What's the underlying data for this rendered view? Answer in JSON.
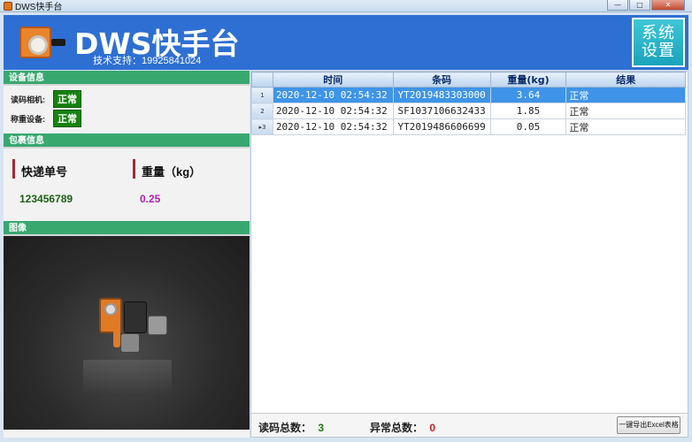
{
  "window": {
    "title": "DWS快手台",
    "minimize": "—",
    "maximize": "□",
    "close": "✕"
  },
  "header": {
    "title": "DWS快手台",
    "support": "技术支持：19925841024",
    "settings_label_line1": "系统",
    "settings_label_line2": "设置",
    "brand_color": "#2e6fd3"
  },
  "device": {
    "section_title": "设备信息",
    "camera_label": "读码相机:",
    "camera_status": "正常",
    "scale_label": "称重设备:",
    "scale_status": "正常",
    "status_color": "#16820f"
  },
  "package": {
    "section_title": "包裹信息",
    "tracking_label": "快递单号",
    "tracking_value": "123456789",
    "weight_label": "重量（kg）",
    "weight_value": "0.25"
  },
  "image": {
    "section_title": "图像"
  },
  "table": {
    "columns": [
      "时间",
      "条码",
      "重量(kg)",
      "结果"
    ],
    "rows": [
      {
        "num": "1",
        "time": "2020-12-10 02:54:32",
        "code": "YT2019483303000",
        "weight": "3.64",
        "result": "正常"
      },
      {
        "num": "2",
        "time": "2020-12-10 02:54:32",
        "code": "SF1037106632433",
        "weight": "1.85",
        "result": "正常"
      },
      {
        "num": "▸3",
        "time": "2020-12-10 02:54:32",
        "code": "YT2019486606699",
        "weight": "0.05",
        "result": "正常"
      }
    ],
    "selected_row_color": "#3e94e8"
  },
  "footer": {
    "read_total_label": "读码总数：",
    "read_total_value": "3",
    "error_total_label": "异常总数：",
    "error_total_value": "0",
    "export_label": "一键导出Excel表格"
  }
}
